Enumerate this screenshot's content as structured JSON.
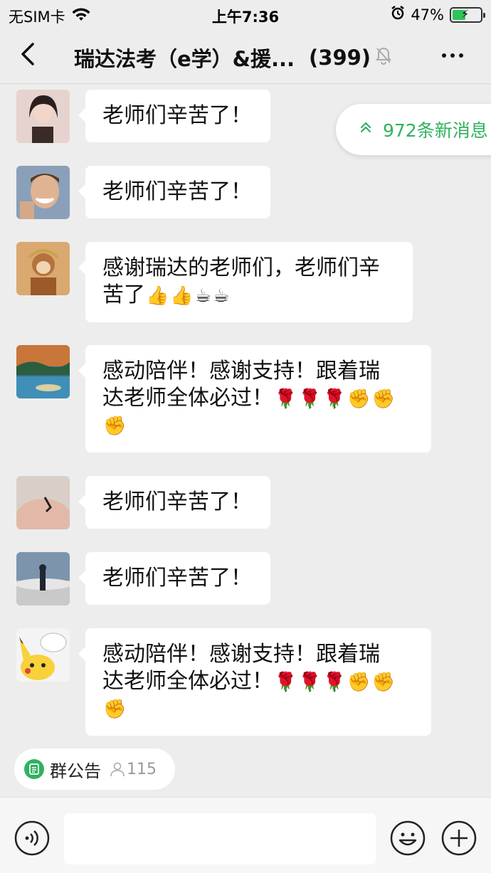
{
  "status_bar": {
    "carrier": "无SIM卡",
    "time": "上午7:36",
    "battery_percent": "47%",
    "battery_level": 0.47
  },
  "nav": {
    "title": "瑞达法考（e学）&援...",
    "member_count": "(399)",
    "back_icon": "chevron-left-icon",
    "mute_icon": "bell-off-icon",
    "more_icon": "more-dots-icon"
  },
  "new_messages": {
    "label": "972条新消息",
    "icon": "double-chevron-up-icon",
    "color": "#2fb25e"
  },
  "messages": [
    {
      "text": "老师们辛苦了！"
    },
    {
      "text": "老师们辛苦了！"
    },
    {
      "line1": "感谢瑞达的老师们，老师们辛",
      "line2": "苦了",
      "emojis": [
        "👍",
        "👍",
        "☕",
        "☕"
      ]
    },
    {
      "line1": "感动陪伴！感谢支持！跟着瑞",
      "line2": "达老师全体必过！",
      "emojis": [
        "🌹",
        "🌹",
        "🌹",
        "✊",
        "✊"
      ],
      "line3_emojis": [
        "✊"
      ]
    },
    {
      "text": "老师们辛苦了！"
    },
    {
      "text": "老师们辛苦了！"
    },
    {
      "line1": "感动陪伴！感谢支持！跟着瑞",
      "line2": "达老师全体必过！",
      "emojis": [
        "🌹",
        "🌹",
        "🌹",
        "✊",
        "✊"
      ],
      "line3_emojis": [
        "✊"
      ]
    }
  ],
  "announcement": {
    "label": "群公告",
    "members": "115",
    "icon": "document-icon",
    "member_icon": "person-icon"
  },
  "input_bar": {
    "placeholder": "",
    "voice_icon": "voice-icon",
    "emoji_icon": "smiley-icon",
    "plus_icon": "plus-circle-icon"
  }
}
